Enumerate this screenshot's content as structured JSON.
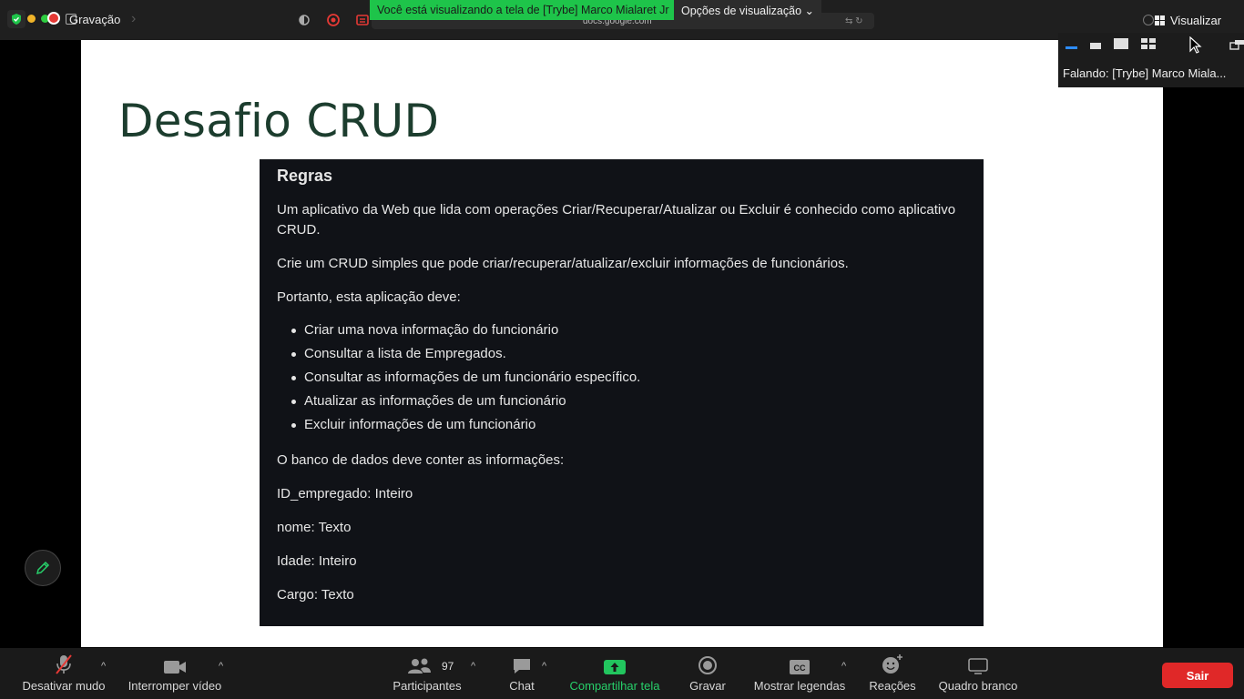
{
  "topbar": {
    "recording_label": "Gravação",
    "share_banner": "Você está visualizando a tela de [Trybe] Marco Mialaret Jr",
    "view_options_label": "Opções de visualização",
    "url_text": "docs.google.com",
    "view_button_label": "Visualizar"
  },
  "speaker_panel": {
    "speaking_text": "Falando: [Trybe] Marco Miala..."
  },
  "slide": {
    "title": "Desafio CRUD",
    "rules_heading": "Regras",
    "paragraph1": "Um aplicativo da Web que lida com operações Criar/Recuperar/Atualizar ou Excluir é conhecido como aplicativo CRUD.",
    "paragraph2": "Crie um CRUD simples que pode criar/recuperar/atualizar/excluir informações de funcionários.",
    "paragraph3": "Portanto, esta aplicação deve:",
    "bullets": [
      "Criar uma nova informação do funcionário",
      "Consultar a lista de Empregados.",
      "Consultar as informações de um funcionário específico.",
      "Atualizar as informações de um funcionário",
      "Excluir informações de um funcionário"
    ],
    "paragraph4": "O banco de dados deve conter as informações:",
    "fields": [
      "ID_empregado: Inteiro",
      "nome: Texto",
      "Idade: Inteiro",
      "Cargo: Texto"
    ]
  },
  "toolbar": {
    "mute_label": "Desativar mudo",
    "video_label": "Interromper vídeo",
    "participants_label": "Participantes",
    "participants_count": "97",
    "chat_label": "Chat",
    "share_label": "Compartilhar tela",
    "record_label": "Gravar",
    "captions_label": "Mostrar legendas",
    "reactions_label": "Reações",
    "whiteboard_label": "Quadro branco",
    "exit_label": "Sair"
  },
  "colors": {
    "accent_green": "#1ec44a",
    "exit_red": "#e02828",
    "title_green": "#1c3d2e",
    "rules_bg": "#101217"
  }
}
